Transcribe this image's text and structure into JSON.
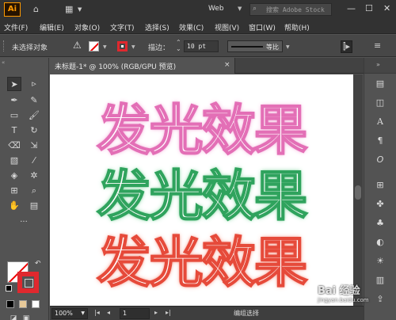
{
  "app": {
    "logo": "Ai",
    "workspace": "Web",
    "search_placeholder": "搜索 Adobe Stock"
  },
  "menu": [
    "文件(F)",
    "编辑(E)",
    "对象(O)",
    "文字(T)",
    "选择(S)",
    "效果(C)",
    "视图(V)",
    "窗口(W)",
    "帮助(H)"
  ],
  "control": {
    "selection_status": "未选择对象",
    "stroke_label": "描边：",
    "stroke_weight": "10 pt",
    "profile": "等比"
  },
  "document": {
    "tab_title": "未标题-1* @ 100% (RGB/GPU 预览)",
    "close": "×"
  },
  "artboard": {
    "lines": [
      {
        "text": "发光效果",
        "color": "#e36fb6"
      },
      {
        "text": "发光效果",
        "color": "#2fa35d"
      },
      {
        "text": "发光效果",
        "color": "#e64a3a"
      }
    ]
  },
  "status": {
    "zoom": "100%",
    "page": "1",
    "info": "编组选择"
  },
  "watermark": {
    "line1": "Bai 经验",
    "line2": "jingyan.baidu.com"
  },
  "colors": {
    "stroke_accent": "#e0282e",
    "logo_accent": "#ff9a00"
  }
}
